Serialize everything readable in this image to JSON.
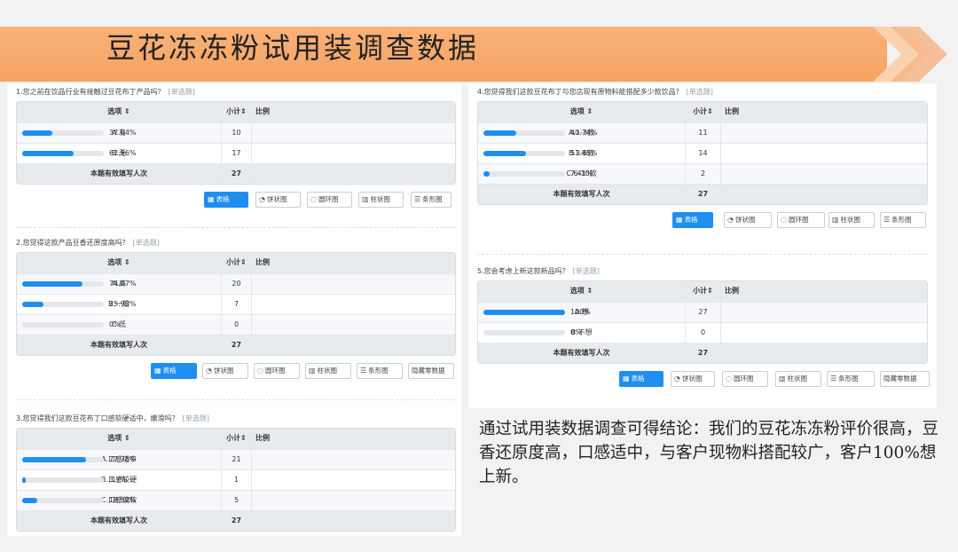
{
  "slide": {
    "title": "豆花冻冻粉试用装调查数据",
    "conclusion": "通过试用装数据调查可得结论：我们的豆花冻冻粉评价很高，豆香还原度高，口感适中，与客户现物料搭配较广，客户100%想上新。"
  },
  "colors": {
    "banner": "#f6a260",
    "accent": "#1f8ef1",
    "bar_track": "#e3e6ea"
  },
  "table_headers": {
    "option": "选项 ⇕",
    "count": "小计⇕",
    "ratio": "比例"
  },
  "total_label": "本题有效填写人次",
  "toolbar_labels": {
    "table": "表格",
    "pie": "饼状图",
    "ring": "圆环图",
    "column": "柱状图",
    "bar": "条形图",
    "hide_zero": "隐藏零数据"
  },
  "toolbar_icons": {
    "table": "table-icon",
    "pie": "pie-chart-icon",
    "ring": "ring-chart-icon",
    "column": "column-chart-icon",
    "bar": "bar-chart-icon"
  },
  "questions": [
    {
      "title": "1.您之前在饮品行业有接触过豆花布丁产品吗？",
      "tag": "[单选题]",
      "rows": [
        {
          "option": "A.有",
          "count": "10",
          "pct_text": "37.04%",
          "pct": 37.04
        },
        {
          "option": "B.无",
          "count": "17",
          "pct_text": "62.96%",
          "pct": 62.96
        }
      ],
      "total": "27"
    },
    {
      "title": "2.您觉得这款产品豆香还原度高吗？",
      "tag": "[单选题]",
      "rows": [
        {
          "option": "A.高",
          "count": "20",
          "pct_text": "74.07%",
          "pct": 74.07
        },
        {
          "option": "B.一般",
          "count": "7",
          "pct_text": "25.93%",
          "pct": 25.93
        },
        {
          "option": "C.低",
          "count": "0",
          "pct_text": "0%",
          "pct": 0
        }
      ],
      "total": "27"
    },
    {
      "title": "3.您觉得我们这款豆花布丁口感软硬适中，嫩滑吗？",
      "tag": "[单选题]",
      "rows": [
        {
          "option": "A.口感适中",
          "count": "21",
          "pct_text": "77.78%",
          "pct": 77.78
        },
        {
          "option": "B.口感较硬",
          "count": "1",
          "pct_text": "3.7%",
          "pct": 3.7
        },
        {
          "option": "C.口感偏软",
          "count": "5",
          "pct_text": "18.52%",
          "pct": 18.52
        }
      ],
      "total": "27"
    },
    {
      "title": "4.您觉得我们这款豆花布丁与您店现有原物料能搭配多少款饮品？",
      "tag": "[单选题]",
      "rows": [
        {
          "option": "A.1-3款",
          "count": "11",
          "pct_text": "40.74%",
          "pct": 40.74
        },
        {
          "option": "B.3-6款",
          "count": "14",
          "pct_text": "51.85%",
          "pct": 51.85
        },
        {
          "option": "C.6-10款",
          "count": "2",
          "pct_text": "7.41%",
          "pct": 7.41
        }
      ],
      "total": "27"
    },
    {
      "title": "5.您会考虑上新这款新品吗？",
      "tag": "[单选题]",
      "rows": [
        {
          "option": "A.想",
          "count": "27",
          "pct_text": "100%",
          "pct": 100
        },
        {
          "option": "B.不想",
          "count": "0",
          "pct_text": "0%",
          "pct": 0
        }
      ],
      "total": "27"
    }
  ]
}
